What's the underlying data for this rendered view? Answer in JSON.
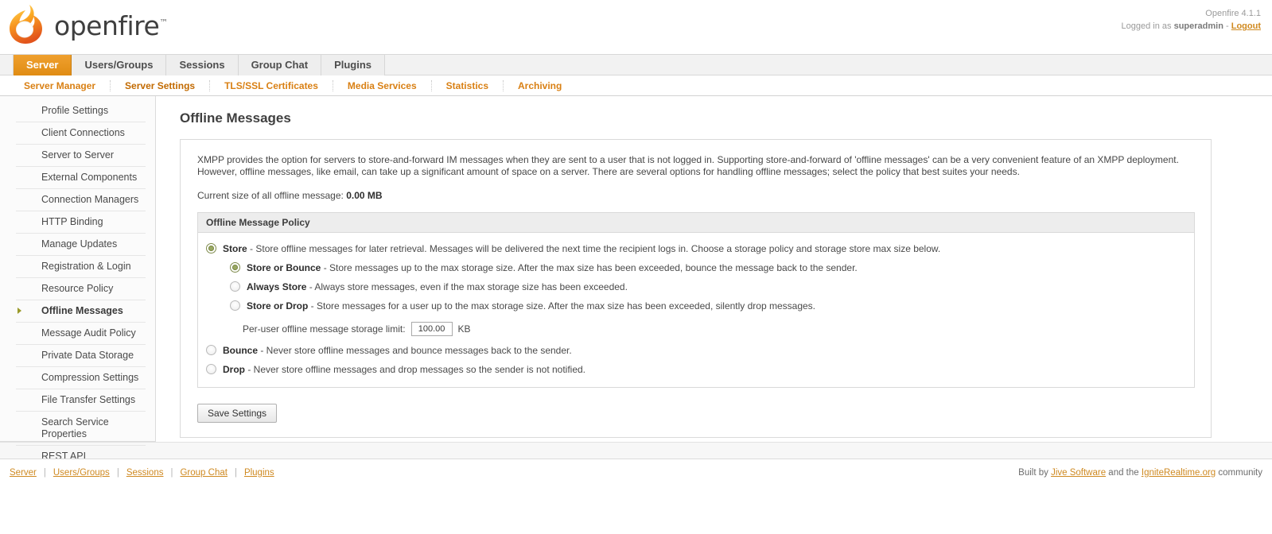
{
  "header": {
    "logo_text": "openfire",
    "logo_tm": "™",
    "version": "Openfire 4.1.1",
    "logged_in_prefix": "Logged in as ",
    "username": "superadmin",
    "logged_in_sep": " - ",
    "logout_label": "Logout"
  },
  "tabs": [
    {
      "label": "Server",
      "active": true
    },
    {
      "label": "Users/Groups",
      "active": false
    },
    {
      "label": "Sessions",
      "active": false
    },
    {
      "label": "Group Chat",
      "active": false
    },
    {
      "label": "Plugins",
      "active": false
    }
  ],
  "subtabs": [
    {
      "label": "Server Manager",
      "active": false
    },
    {
      "label": "Server Settings",
      "active": true
    },
    {
      "label": "TLS/SSL Certificates",
      "active": false
    },
    {
      "label": "Media Services",
      "active": false
    },
    {
      "label": "Statistics",
      "active": false
    },
    {
      "label": "Archiving",
      "active": false
    }
  ],
  "sidebar": {
    "items": [
      {
        "label": "Profile Settings",
        "active": false
      },
      {
        "label": "Client Connections",
        "active": false
      },
      {
        "label": "Server to Server",
        "active": false
      },
      {
        "label": "External Components",
        "active": false
      },
      {
        "label": "Connection Managers",
        "active": false
      },
      {
        "label": "HTTP Binding",
        "active": false
      },
      {
        "label": "Manage Updates",
        "active": false
      },
      {
        "label": "Registration & Login",
        "active": false
      },
      {
        "label": "Resource Policy",
        "active": false
      },
      {
        "label": "Offline Messages",
        "active": true
      },
      {
        "label": "Message Audit Policy",
        "active": false
      },
      {
        "label": "Private Data Storage",
        "active": false
      },
      {
        "label": "Compression Settings",
        "active": false
      },
      {
        "label": "File Transfer Settings",
        "active": false
      },
      {
        "label": "Search Service Properties",
        "active": false
      },
      {
        "label": "REST API",
        "active": false
      }
    ]
  },
  "main": {
    "page_title": "Offline Messages",
    "intro_line1": "XMPP provides the option for servers to store-and-forward IM messages when they are sent to a user that is not logged in. Supporting store-and-forward of 'offline messages' can be a very convenient feature of an XMPP deployment.",
    "intro_line2": "However, offline messages, like email, can take up a significant amount of space on a server. There are several options for handling offline messages; select the policy that best suites your needs.",
    "current_size_label": "Current size of all offline message: ",
    "current_size_value": "0.00 MB",
    "policy_header": "Offline Message Policy",
    "options": {
      "store": {
        "title": "Store",
        "desc": " - Store offline messages for later retrieval. Messages will be delivered the next time the recipient logs in. Choose a storage policy and storage store max size below.",
        "checked": true
      },
      "store_or_bounce": {
        "title": "Store or Bounce",
        "desc": " - Store messages up to the max storage size. After the max size has been exceeded, bounce the message back to the sender.",
        "checked": true
      },
      "always_store": {
        "title": "Always Store",
        "desc": " - Always store messages, even if the max storage size has been exceeded.",
        "checked": false
      },
      "store_or_drop": {
        "title": "Store or Drop",
        "desc": " - Store messages for a user up to the max storage size. After the max size has been exceeded, silently drop messages.",
        "checked": false
      },
      "bounce": {
        "title": "Bounce",
        "desc": " - Never store offline messages and bounce messages back to the sender.",
        "checked": false
      },
      "drop": {
        "title": "Drop",
        "desc": " - Never store offline messages and drop messages so the sender is not notified.",
        "checked": false
      }
    },
    "limit_label": "Per-user offline message storage limit:",
    "limit_value": "100.00",
    "limit_unit": "KB",
    "save_label": "Save Settings"
  },
  "footer": {
    "links": [
      "Server",
      "Users/Groups",
      "Sessions",
      "Group Chat",
      "Plugins"
    ],
    "built_by_prefix": "Built by ",
    "jive_label": "Jive Software",
    "and_the": " and the ",
    "ignite_label": "IgniteRealtime.org",
    "community_suffix": " community"
  },
  "colors": {
    "accent_orange": "#e08c13",
    "link_orange": "#cf8a22",
    "radio_selected": "#99a862"
  }
}
